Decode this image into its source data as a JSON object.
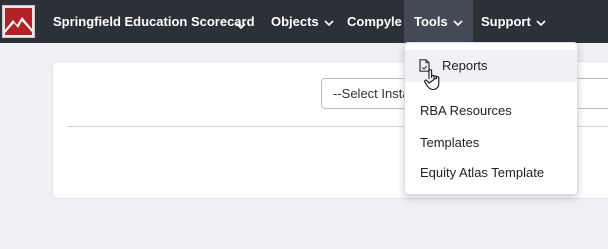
{
  "navbar": {
    "app_title": "Springfield Education Scorecard",
    "items": [
      {
        "label": "Objects",
        "has_dropdown": true
      },
      {
        "label": "Compyle",
        "has_dropdown": false
      },
      {
        "label": "Tools",
        "has_dropdown": true,
        "active": true
      },
      {
        "label": "Support",
        "has_dropdown": true
      }
    ],
    "logo_icon": "mountain-logo-icon",
    "colors": {
      "background": "#2c3037",
      "active": "#434955",
      "logo_red": "#b42025"
    }
  },
  "main": {
    "instance_select": {
      "value": "--Select Instan"
    }
  },
  "tools_menu": {
    "items": [
      {
        "label": "Reports",
        "icon": "document-icon"
      },
      {
        "label": "RBA Resources"
      },
      {
        "label": "Templates"
      },
      {
        "label": "Equity Atlas Template"
      }
    ]
  },
  "cursor": {
    "icon": "hand-pointer-icon"
  }
}
